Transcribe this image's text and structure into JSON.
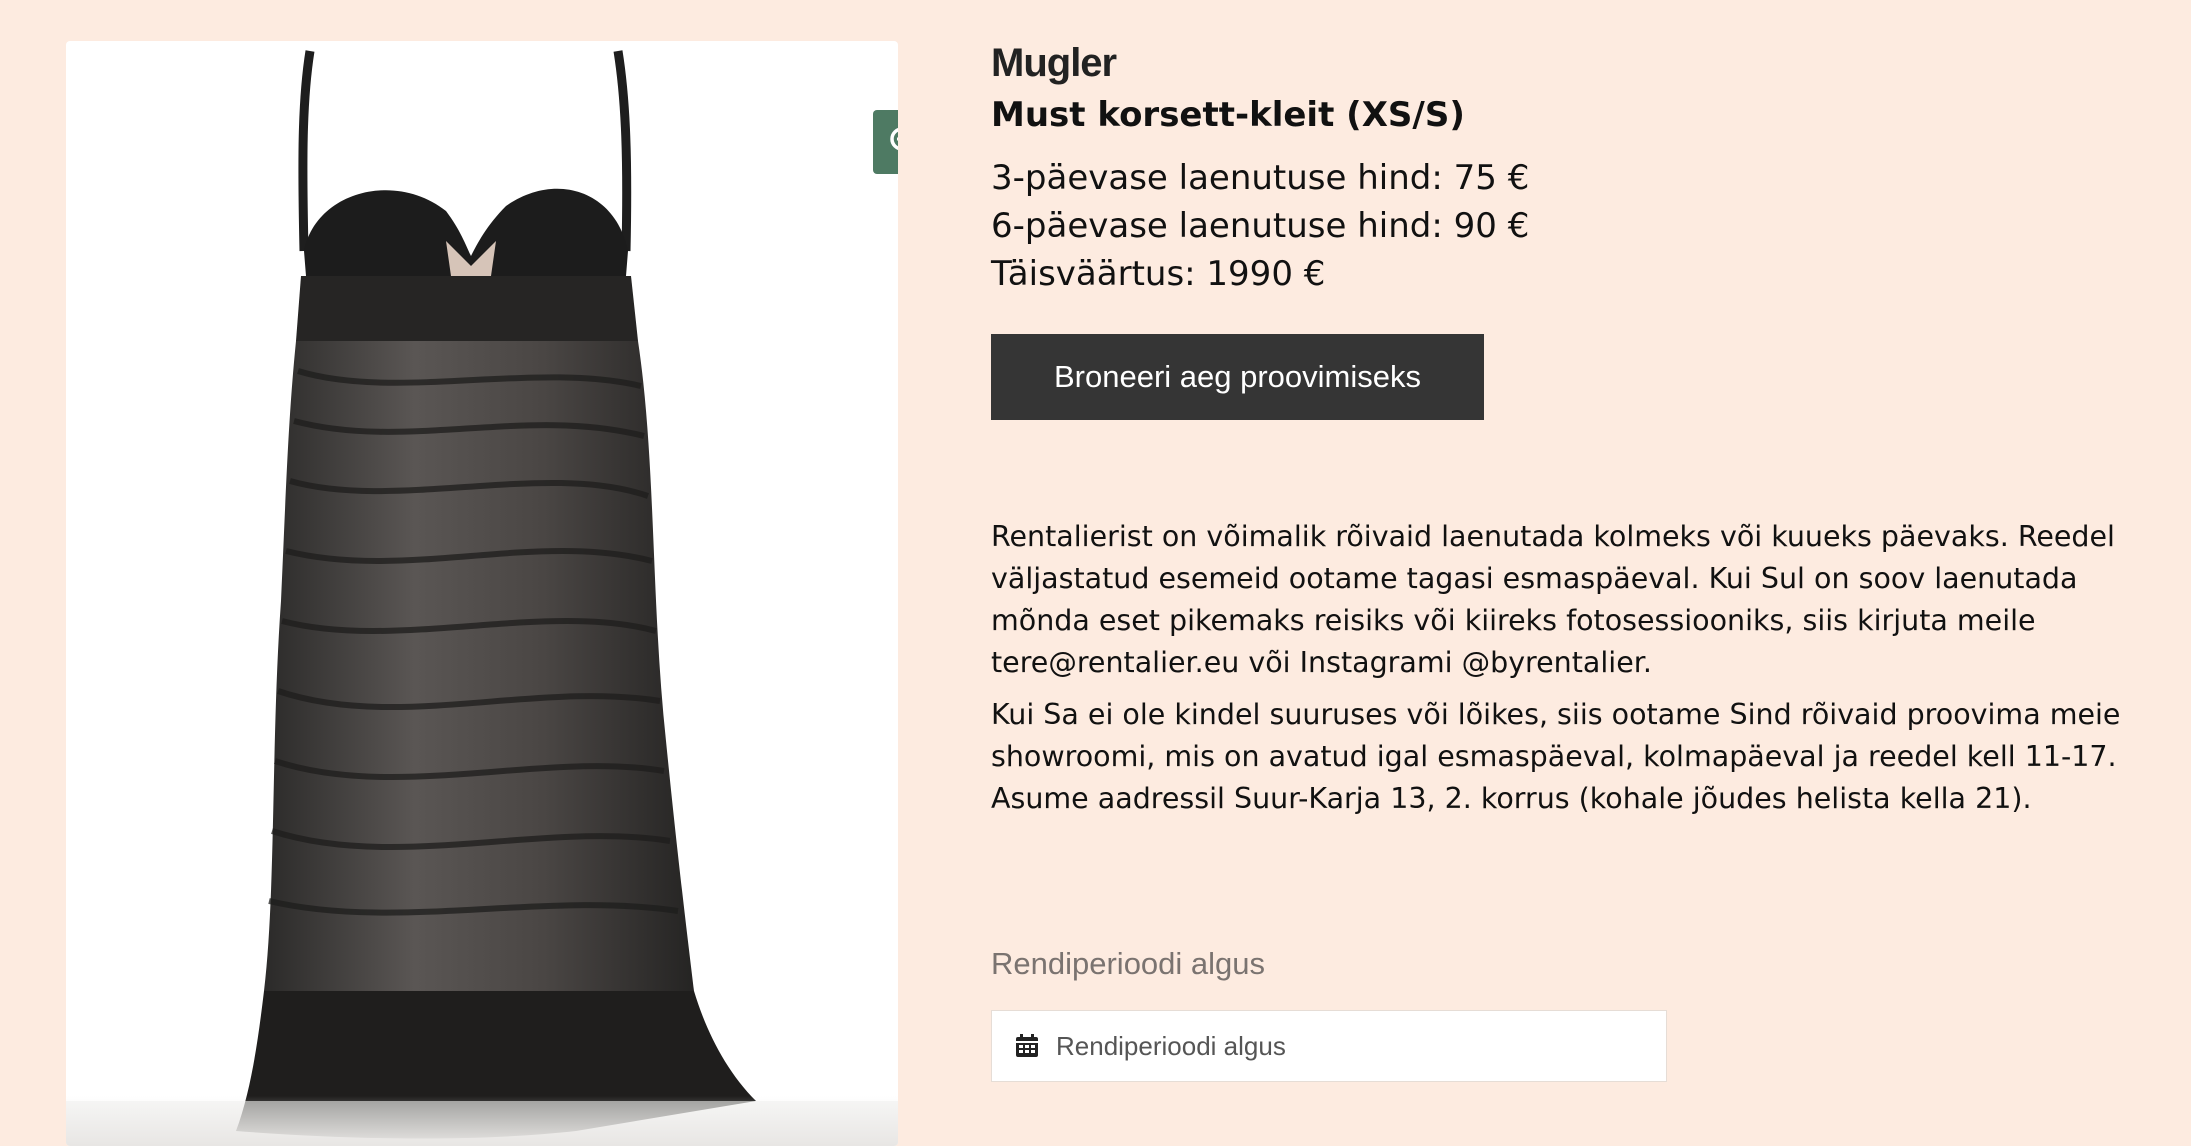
{
  "product": {
    "brand": "Mugler",
    "title": "Must korsett-kleit (XS/S)",
    "price_3_day": "3-päevase laenutuse hind: 75 €",
    "price_6_day": "6-päevase laenutuse hind: 90 €",
    "full_value": "Täisväärtus: 1990 €"
  },
  "actions": {
    "book_label": "Broneeri aeg proovimiseks",
    "zoom_icon": "zoom-in-icon"
  },
  "description": {
    "paragraph_1": "Rentalierist on võimalik rõivaid laenutada kolmeks või kuueks päevaks. Reedel väljastatud esemeid ootame tagasi esmaspäeval. Kui Sul on soov laenutada mõnda eset pikemaks reisiks või kiireks fotosessiooniks, siis kirjuta meile tere@rentalier.eu või Instagrami @byrentalier.",
    "paragraph_2": "Kui Sa ei ole kindel suuruses või lõikes, siis ootame Sind rõivaid proovima meie showroomi, mis on avatud igal esmaspäeval, kolmapäeval ja reedel kell 11-17. Asume aadressil Suur-Karja 13, 2. korrus (kohale jõudes helista kella 21)."
  },
  "rental_form": {
    "label": "Rendiperioodi algus",
    "placeholder": "Rendiperioodi algus",
    "icon": "calendar-icon"
  },
  "colors": {
    "background": "#fdebe0",
    "zoom_button": "#4e7a63",
    "book_button": "#353535"
  }
}
